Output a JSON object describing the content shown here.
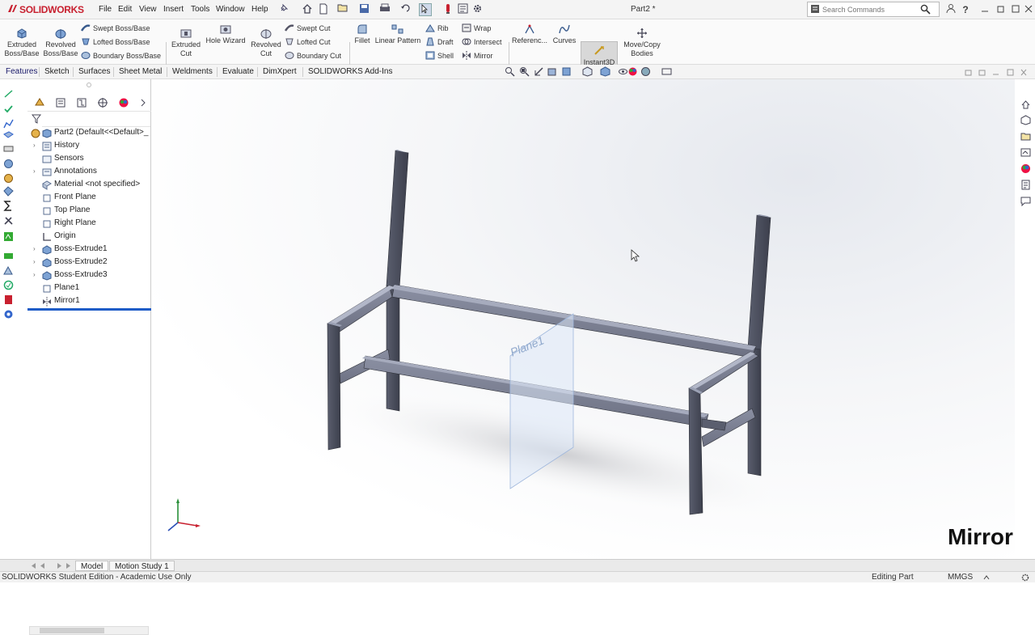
{
  "app": {
    "logo_text": "SOLIDWORKS",
    "document_title": "Part2 *",
    "accent_color": "#c8202f",
    "selection_color": "#1e5cc7"
  },
  "menubar": {
    "items": [
      "File",
      "Edit",
      "View",
      "Insert",
      "Tools",
      "Window",
      "Help"
    ]
  },
  "search": {
    "placeholder": "Search Commands"
  },
  "ribbon": {
    "extruded_boss": "Extruded Boss/Base",
    "revolved_boss": "Revolved Boss/Base",
    "swept_boss": "Swept Boss/Base",
    "lofted_boss": "Lofted Boss/Base",
    "boundary_boss": "Boundary Boss/Base",
    "extruded_cut": "Extruded Cut",
    "hole_wizard": "Hole Wizard",
    "revolved_cut": "Revolved Cut",
    "swept_cut": "Swept Cut",
    "lofted_cut": "Lofted Cut",
    "boundary_cut": "Boundary Cut",
    "fillet": "Fillet",
    "linear_pattern": "Linear Pattern",
    "rib": "Rib",
    "draft": "Draft",
    "shell": "Shell",
    "wrap": "Wrap",
    "intersect": "Intersect",
    "mirror": "Mirror",
    "reference": "Referenc...",
    "curves": "Curves",
    "instant3d": "Instant3D",
    "move_copy": "Move/Copy Bodies"
  },
  "tabs": [
    "Features",
    "Sketch",
    "Surfaces",
    "Sheet Metal",
    "Weldments",
    "Evaluate",
    "DimXpert",
    "SOLIDWORKS Add-Ins"
  ],
  "feature_tree": {
    "root": "Part2  (Default<<Default>_",
    "items": [
      {
        "label": "History",
        "expandable": true
      },
      {
        "label": "Sensors",
        "expandable": false
      },
      {
        "label": "Annotations",
        "expandable": true
      },
      {
        "label": "Material <not specified>",
        "expandable": false
      },
      {
        "label": "Front Plane",
        "expandable": false
      },
      {
        "label": "Top Plane",
        "expandable": false
      },
      {
        "label": "Right Plane",
        "expandable": false
      },
      {
        "label": "Origin",
        "expandable": false
      },
      {
        "label": "Boss-Extrude1",
        "expandable": true
      },
      {
        "label": "Boss-Extrude2",
        "expandable": true
      },
      {
        "label": "Boss-Extrude3",
        "expandable": true
      },
      {
        "label": "Plane1",
        "expandable": false
      },
      {
        "label": "Mirror1",
        "expandable": false
      }
    ]
  },
  "viewport": {
    "plane_label": "Plane1",
    "overlay_caption": "Mirror"
  },
  "bottom_tabs": [
    "Model",
    "Motion Study 1"
  ],
  "status": {
    "left": "SOLIDWORKS Student Edition - Academic Use Only",
    "mode": "Editing Part",
    "units": "MMGS"
  }
}
